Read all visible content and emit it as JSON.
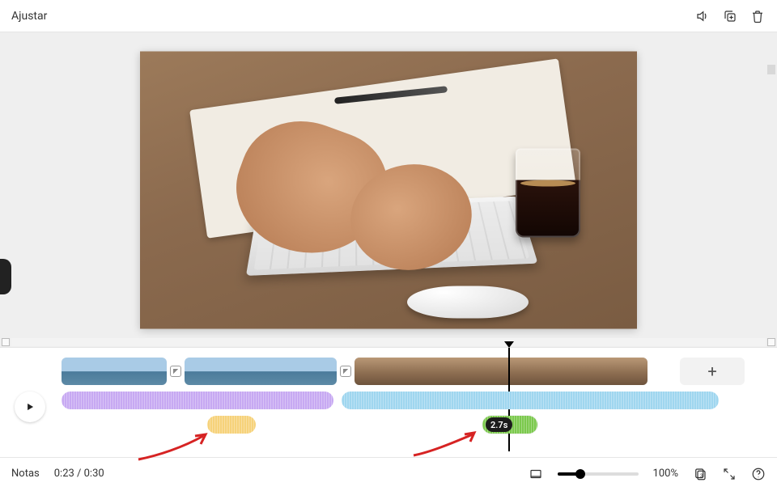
{
  "topbar": {
    "title": "Ajustar",
    "icons": {
      "volume": "volume-icon",
      "duplicate": "duplicate-icon",
      "trash": "trash-icon"
    }
  },
  "timeline": {
    "green_clip_duration": "2.7s",
    "add_page": "+"
  },
  "bottom": {
    "notes_label": "Notas",
    "time_display": "0:23 / 0:30",
    "zoom_pct": "100%"
  }
}
